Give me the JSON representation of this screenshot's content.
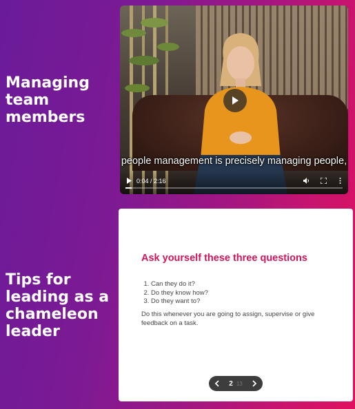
{
  "sections": [
    {
      "title": "Managing team members"
    },
    {
      "title": "Tips for leading as a chameleon leader"
    }
  ],
  "video": {
    "caption": "people management is precisely managing people,",
    "time": "0:04 / 2:16",
    "progress": 0.03,
    "icons": [
      "play-icon",
      "volume-icon",
      "fullscreen-icon",
      "more-options-icon"
    ]
  },
  "card": {
    "heading": "Ask yourself these three questions",
    "questions": [
      "Can they do it?",
      "Do they know how?",
      "Do they want to?"
    ],
    "body": "Do this whenever you are going to assign, supervise or give feedback on a task."
  },
  "pager": {
    "current": "2",
    "total": "13"
  },
  "colors": {
    "accent": "#d4145a",
    "gradient_start": "#6a1b9a",
    "gradient_end": "#e0105f"
  }
}
